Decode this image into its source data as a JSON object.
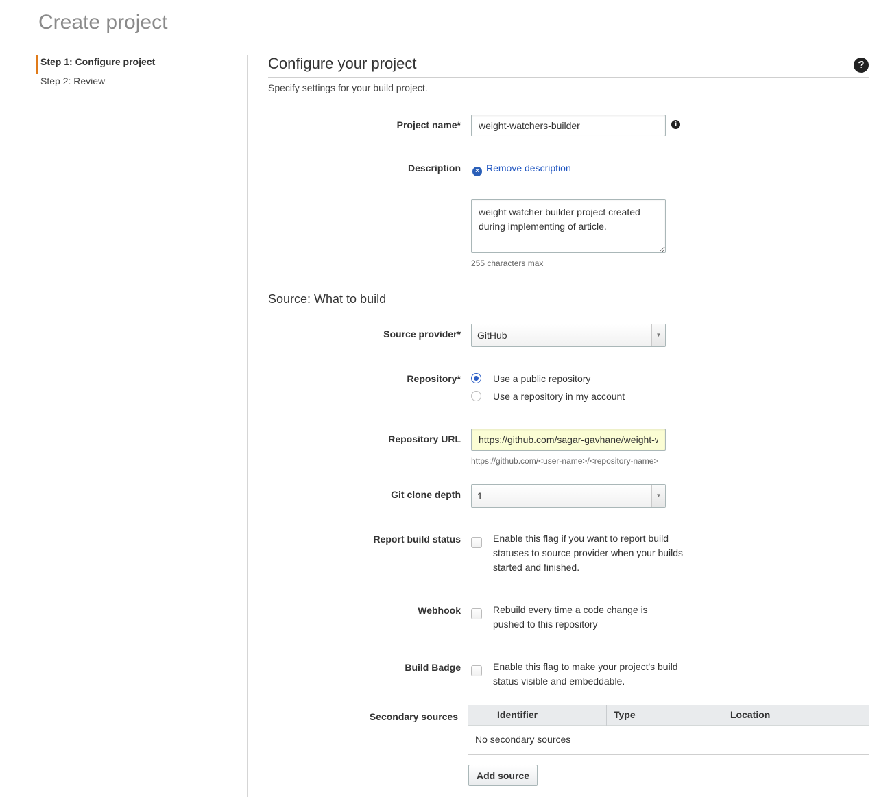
{
  "page": {
    "title": "Create project"
  },
  "steps": [
    {
      "label": "Step 1: Configure project",
      "active": true
    },
    {
      "label": "Step 2: Review",
      "active": false
    }
  ],
  "configure": {
    "title": "Configure your project",
    "subtitle": "Specify settings for your build project.",
    "help_icon": "?"
  },
  "project_name": {
    "label": "Project name*",
    "value": "weight-watchers-builder",
    "info_icon": "i"
  },
  "description": {
    "label": "Description",
    "remove_label": "Remove description",
    "remove_icon": "×",
    "value": "weight watcher builder project created during implementing of article.",
    "hint": "255 characters max"
  },
  "source": {
    "title": "Source: What to build",
    "provider": {
      "label": "Source provider*",
      "value": "GitHub",
      "arrow": "▼"
    },
    "repository": {
      "label": "Repository*",
      "options": [
        {
          "label": "Use a public repository",
          "checked": true
        },
        {
          "label": "Use a repository in my account",
          "checked": false
        }
      ]
    },
    "repo_url": {
      "label": "Repository URL",
      "value": "https://github.com/sagar-gavhane/weight-watchers",
      "hint": "https://github.com/<user-name>/<repository-name>"
    },
    "clone_depth": {
      "label": "Git clone depth",
      "value": "1",
      "arrow": "▼"
    },
    "report_build_status": {
      "label": "Report build status",
      "text": "Enable this flag if you want to report build statuses to source provider when your builds started and finished.",
      "checked": false
    },
    "webhook": {
      "label": "Webhook",
      "text": "Rebuild every time a code change is pushed to this repository",
      "checked": false
    },
    "build_badge": {
      "label": "Build Badge",
      "text": "Enable this flag to make your project's build status visible and embeddable.",
      "checked": false
    },
    "secondary_sources": {
      "label": "Secondary sources",
      "columns": [
        "Identifier",
        "Type",
        "Location"
      ],
      "empty_text": "No secondary sources",
      "add_button": "Add source"
    }
  }
}
